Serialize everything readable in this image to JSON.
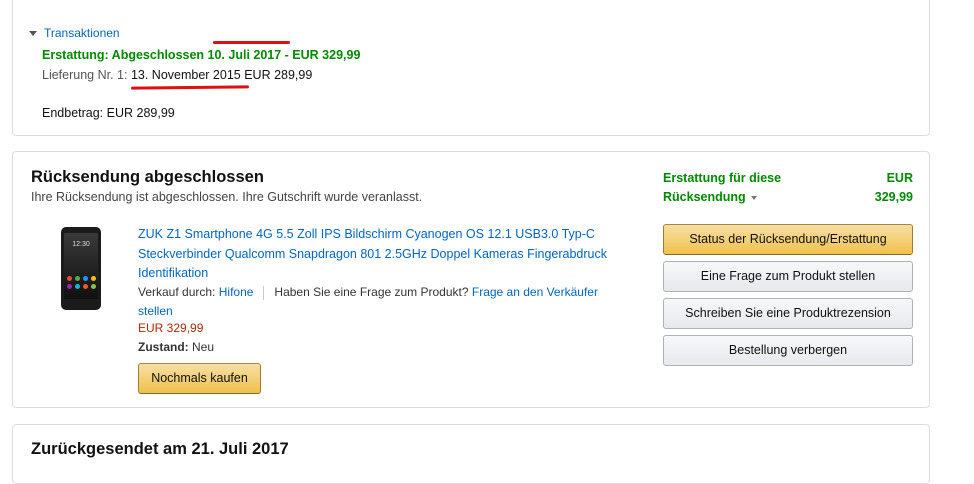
{
  "transactions": {
    "toggle_label": "Transaktionen",
    "refund_line": "Erstattung: Abgeschlossen 10. Juli 2017 - EUR 329,99",
    "delivery_label": "Lieferung Nr. 1:",
    "delivery_value": "13. November 2015 EUR 289,99",
    "total_label": "Endbetrag:",
    "total_value": "EUR 289,99"
  },
  "return_box": {
    "title": "Rücksendung abgeschlossen",
    "subtitle": "Ihre Rücksendung ist abgeschlossen. Ihre Gutschrift wurde veranlasst.",
    "refund_label_1": "Erstattung für diese",
    "refund_label_2": "Rücksendung",
    "refund_currency": "EUR",
    "refund_amount": "329,99",
    "product": {
      "title": "ZUK Z1 Smartphone 4G 5.5 Zoll IPS Bildschirm Cyanogen OS 12.1 USB3.0 Typ-C Steckverbinder Qualcomm Snapdragon 801 2.5GHz Doppel Kameras Fingerabdruck Identifikation",
      "sold_by_label": "Verkauf durch:",
      "seller": "Hifone",
      "question_text": "Haben Sie eine Frage zum Produkt?",
      "ask_seller_link": "Frage an den Verkäufer stellen",
      "price": "EUR 329,99",
      "condition_label": "Zustand:",
      "condition_value": "Neu",
      "phone_time": "12:30"
    },
    "buy_again_button": "Nochmals kaufen",
    "buttons": [
      "Status der Rücksendung/Erstattung",
      "Eine Frage zum Produkt stellen",
      "Schreiben Sie eine Produktrezension",
      "Bestellung verbergen"
    ]
  },
  "returned_box": {
    "title": "Zurückgesendet am 21. Juli 2017"
  },
  "colors": {
    "link": "#0066c0",
    "success_green": "#008a00",
    "price_red": "#b12704",
    "annotation_red": "#e01010",
    "primary_button": "#f0c14b"
  }
}
